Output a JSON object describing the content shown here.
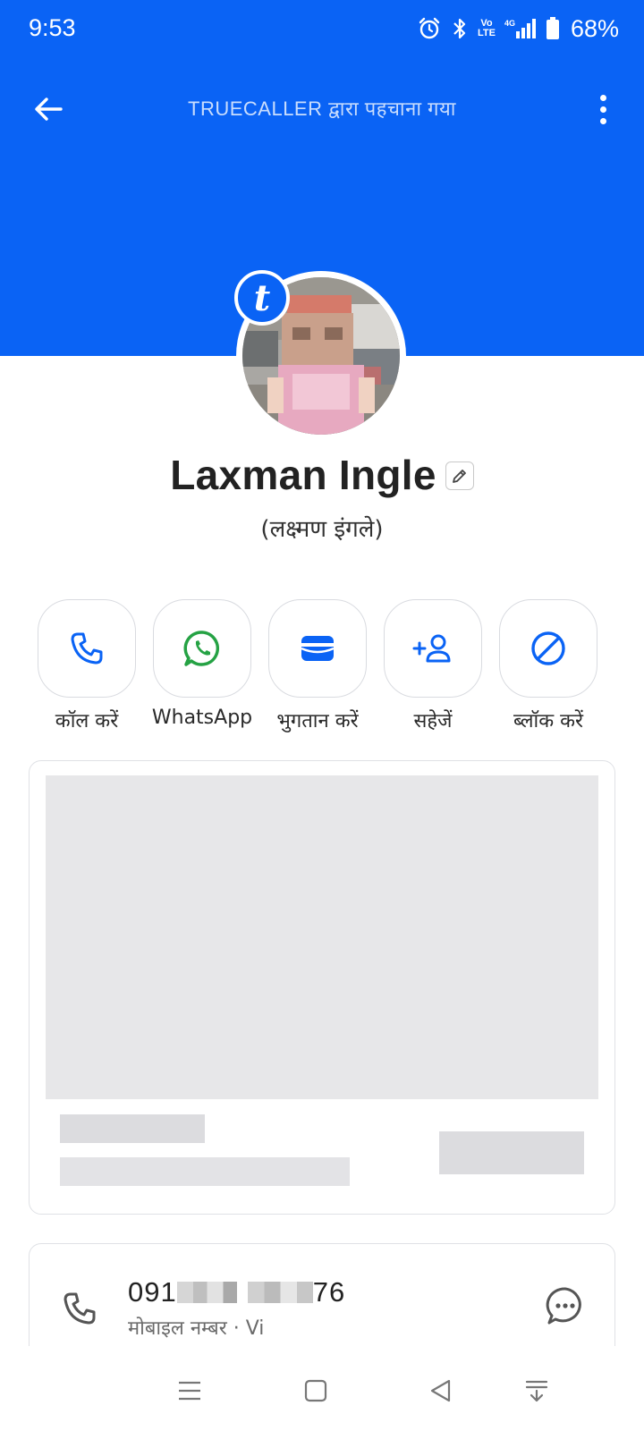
{
  "status_bar": {
    "time": "9:53",
    "battery": "68%"
  },
  "header": {
    "title": "TRUECALLER द्वारा पहचाना गया"
  },
  "profile": {
    "name": "Laxman Ingle",
    "alt_name": "(लक्ष्मण इंगले)",
    "badge_letter": "t"
  },
  "actions": [
    {
      "label": "कॉल करें",
      "icon": "phone-icon"
    },
    {
      "label": "WhatsApp",
      "icon": "whatsapp-icon"
    },
    {
      "label": "भुगतान करें",
      "icon": "wallet-icon"
    },
    {
      "label": "सहेजें",
      "icon": "add-person-icon"
    },
    {
      "label": "ब्लॉक करें",
      "icon": "block-icon"
    }
  ],
  "number_card": {
    "number_prefix": "091",
    "number_suffix": "76",
    "subtitle": "मोबाइल नम्बर · Vi"
  },
  "colors": {
    "brand_blue": "#0a63f5",
    "whatsapp_green": "#25a244"
  }
}
